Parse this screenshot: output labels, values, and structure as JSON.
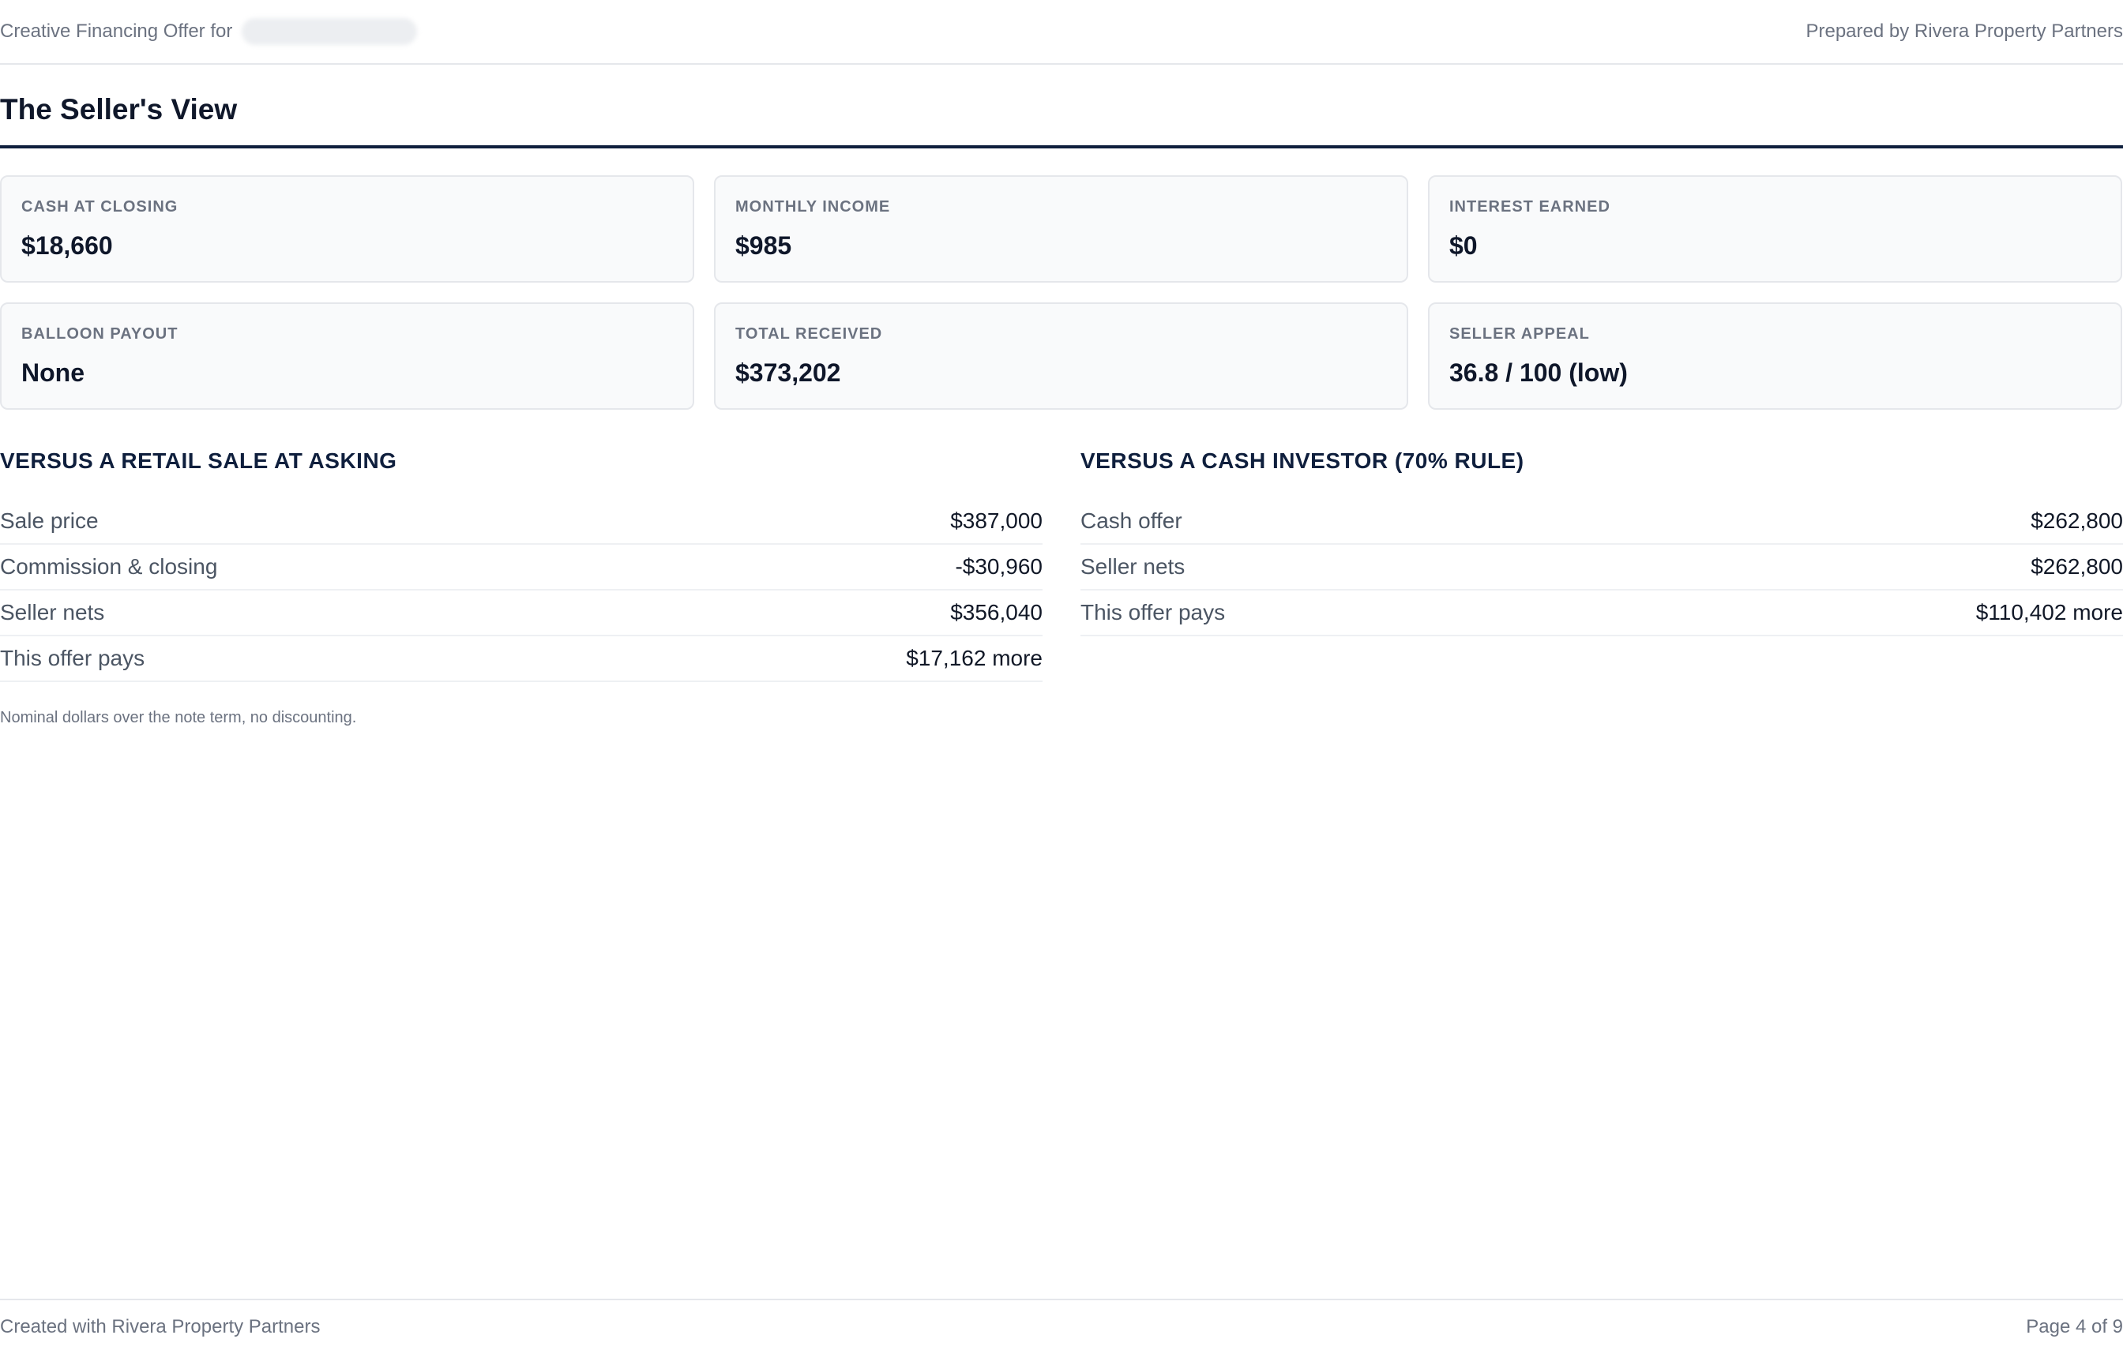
{
  "header": {
    "offer_prefix": "Creative Financing Offer for",
    "prepared_by": "Prepared by Rivera Property Partners"
  },
  "page_title": "The Seller's View",
  "metrics": [
    {
      "label": "CASH AT CLOSING",
      "value": "$18,660"
    },
    {
      "label": "MONTHLY INCOME",
      "value": "$985"
    },
    {
      "label": "INTEREST EARNED",
      "value": "$0"
    },
    {
      "label": "BALLOON PAYOUT",
      "value": "None"
    },
    {
      "label": "TOTAL RECEIVED",
      "value": "$373,202"
    },
    {
      "label": "SELLER APPEAL",
      "value": "36.8 / 100 (low)"
    }
  ],
  "retail": {
    "heading": "VERSUS A RETAIL SALE AT ASKING",
    "rows": [
      {
        "label": "Sale price",
        "value": "$387,000"
      },
      {
        "label": "Commission & closing",
        "value": "-$30,960"
      },
      {
        "label": "Seller nets",
        "value": "$356,040"
      },
      {
        "label": "This offer pays",
        "value": "$17,162 more"
      }
    ]
  },
  "investor": {
    "heading": "VERSUS A CASH INVESTOR (70% RULE)",
    "rows": [
      {
        "label": "Cash offer",
        "value": "$262,800"
      },
      {
        "label": "Seller nets",
        "value": "$262,800"
      },
      {
        "label": "This offer pays",
        "value": "$110,402 more"
      }
    ]
  },
  "note": "Nominal dollars over the note term, no discounting.",
  "footer": {
    "created_with": "Created with Rivera Property Partners",
    "page_indicator": "Page 4 of 9"
  }
}
